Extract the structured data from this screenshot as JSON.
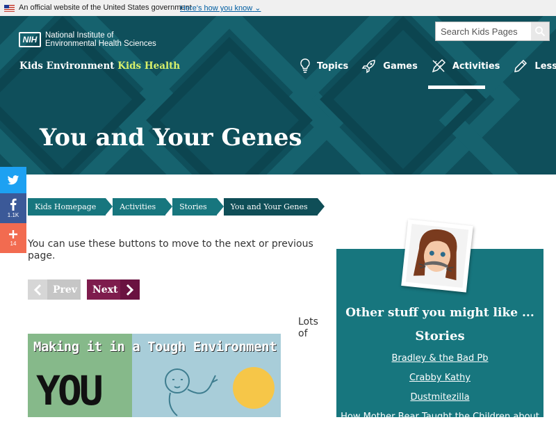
{
  "gov_banner": {
    "text": "An official website of the United States government",
    "link": "Here's how you know"
  },
  "header": {
    "nih_mark": "NIH",
    "nih_name_line1": "National Institute of",
    "nih_name_line2": "Environmental Health Sciences",
    "site_name_part1": "Kids Environment",
    "site_name_part2": "Kids Health",
    "search_placeholder": "Search Kids Pages",
    "nav": [
      {
        "label": "Topics",
        "icon": "lightbulb-icon"
      },
      {
        "label": "Games",
        "icon": "rocket-icon"
      },
      {
        "label": "Activities",
        "icon": "pencil-ruler-icon"
      },
      {
        "label": "Lessons",
        "icon": "pencil-icon"
      }
    ],
    "active_nav": "Activities",
    "page_title": "You and Your Genes"
  },
  "share": [
    {
      "icon": "twitter-icon",
      "color": "#1da1f2",
      "count": ""
    },
    {
      "icon": "facebook-icon",
      "color": "#3b5998",
      "count": "1.1K"
    },
    {
      "icon": "plus-icon",
      "color": "#f26b50",
      "count": "14"
    }
  ],
  "breadcrumbs": [
    "Kids Homepage",
    "Activities",
    "Stories",
    "You and Your Genes"
  ],
  "main": {
    "intro": "You can use these buttons to move to the next or previous page.",
    "prev_label": "Prev",
    "next_label": "Next",
    "lots_text": "Lots of",
    "cover_title": "Making it in a Tough Environment",
    "cover_big": "YOU"
  },
  "sidebar": {
    "heading": "Other stuff you might like ...",
    "section": "Stories",
    "links": [
      "Bradley & the Bad Pb",
      "Crabby Kathy",
      "Dustmitezilla",
      "How Mother Bear Taught the Children about"
    ]
  },
  "colors": {
    "header_teal": "#0f4f5b",
    "accent_teal": "#17767e",
    "next_button": "#7e1c4d",
    "site_green": "#d8f06a"
  }
}
